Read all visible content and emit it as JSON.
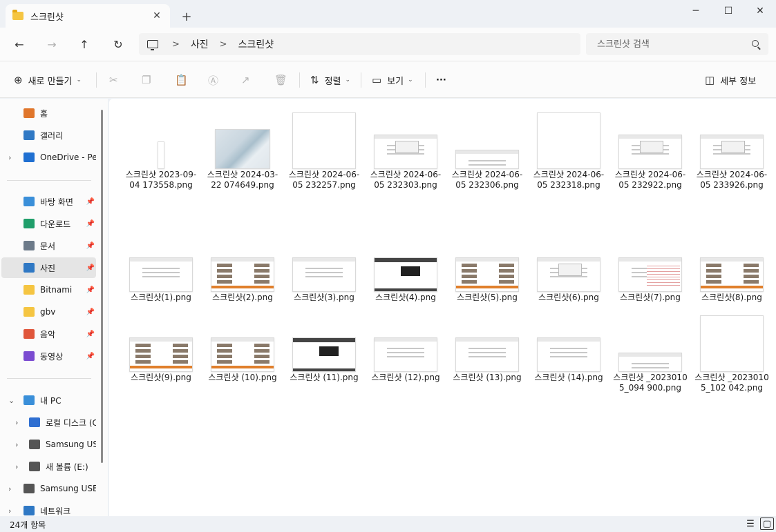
{
  "window": {
    "tab_title": "스크린샷",
    "tab_close": "✕",
    "new_tab": "+",
    "minimize": "─",
    "maximize": "☐",
    "close": "✕"
  },
  "nav": {
    "back": "←",
    "forward": "→",
    "up": "↑",
    "refresh": "↻",
    "breadcrumbs": [
      "사진",
      "스크린샷"
    ],
    "breadcrumb_sep": ">",
    "search_placeholder": "스크린샷 검색"
  },
  "commands": {
    "new": "새로 만들기",
    "sort": "정렬",
    "view": "보기",
    "more": "···",
    "details": "세부 정보",
    "caret": "⌄"
  },
  "sidebar": {
    "quick": [
      {
        "label": "홈",
        "icon": "home-icon",
        "color": "#e0762b"
      },
      {
        "label": "갤러리",
        "icon": "gallery-icon",
        "color": "#2f78c4"
      },
      {
        "label": "OneDrive - Pers",
        "icon": "cloud-icon",
        "color": "#1f6fd1"
      }
    ],
    "pinned": [
      {
        "label": "바탕 화면",
        "icon": "desktop-icon",
        "color": "#3a8fd9"
      },
      {
        "label": "다운로드",
        "icon": "download-icon",
        "color": "#1f9e6a"
      },
      {
        "label": "문서",
        "icon": "document-icon",
        "color": "#6c7a89"
      },
      {
        "label": "사진",
        "icon": "pictures-icon",
        "color": "#2f78c4"
      },
      {
        "label": "Bitnami",
        "icon": "folder-icon",
        "color": "#f5c542"
      },
      {
        "label": "gbv",
        "icon": "folder-icon",
        "color": "#f5c542"
      },
      {
        "label": "음악",
        "icon": "music-icon",
        "color": "#e0563b"
      },
      {
        "label": "동영상",
        "icon": "video-icon",
        "color": "#7b4bd1"
      }
    ],
    "devices": [
      {
        "label": "내 PC",
        "icon": "pc-icon",
        "color": "#3a8fd9"
      },
      {
        "label": "로컬 디스크 (C",
        "icon": "windows-drive-icon",
        "color": "#2f6fd1"
      },
      {
        "label": "Samsung USB",
        "icon": "usb-drive-icon",
        "color": "#555555"
      },
      {
        "label": "새 볼륨 (E:)",
        "icon": "drive-icon",
        "color": "#555555"
      },
      {
        "label": "Samsung USB (",
        "icon": "usb-drive-icon",
        "color": "#555555"
      },
      {
        "label": "네트워크",
        "icon": "network-icon",
        "color": "#2f78c4"
      }
    ],
    "pin_glyph": "📌",
    "chevron_right": "›",
    "chevron_down": "⌄"
  },
  "files": [
    {
      "name": "스크린샷 2023-09-04 173558.png",
      "style": "tall"
    },
    {
      "name": "스크린샷 2024-03-22 074649.png",
      "style": "wave"
    },
    {
      "name": "스크린샷 2024-06-05 232257.png",
      "style": "blank"
    },
    {
      "name": "스크린샷 2024-06-05 232303.png",
      "style": "dialog"
    },
    {
      "name": "스크린샷 2024-06-05 232306.png",
      "style": "short"
    },
    {
      "name": "스크린샷 2024-06-05 232318.png",
      "style": "blank"
    },
    {
      "name": "스크린샷 2024-06-05 232922.png",
      "style": "dialog"
    },
    {
      "name": "스크린샷 2024-06-05 233926.png",
      "style": "dialog"
    },
    {
      "name": "스크린샷(1).png",
      "style": "page"
    },
    {
      "name": "스크린샷(2).png",
      "style": "shop"
    },
    {
      "name": "스크린샷(3).png",
      "style": "page"
    },
    {
      "name": "스크린샷(4).png",
      "style": "dark"
    },
    {
      "name": "스크린샷(5).png",
      "style": "shop"
    },
    {
      "name": "스크린샷(6).png",
      "style": "dialog"
    },
    {
      "name": "스크린샷(7).png",
      "style": "sheet"
    },
    {
      "name": "스크린샷(8).png",
      "style": "shop"
    },
    {
      "name": "스크린샷(9).png",
      "style": "shop"
    },
    {
      "name": "스크린샷 (10).png",
      "style": "shop"
    },
    {
      "name": "스크린샷 (11).png",
      "style": "dark"
    },
    {
      "name": "스크린샷 (12).png",
      "style": "page"
    },
    {
      "name": "스크린샷 (13).png",
      "style": "page"
    },
    {
      "name": "스크린샷 (14).png",
      "style": "page"
    },
    {
      "name": "스크린샷 _20230105_094 900.png",
      "style": "short"
    },
    {
      "name": "스크린샷 _20230105_102 042.png",
      "style": "blank"
    }
  ],
  "status": {
    "count": "24개 항목"
  }
}
